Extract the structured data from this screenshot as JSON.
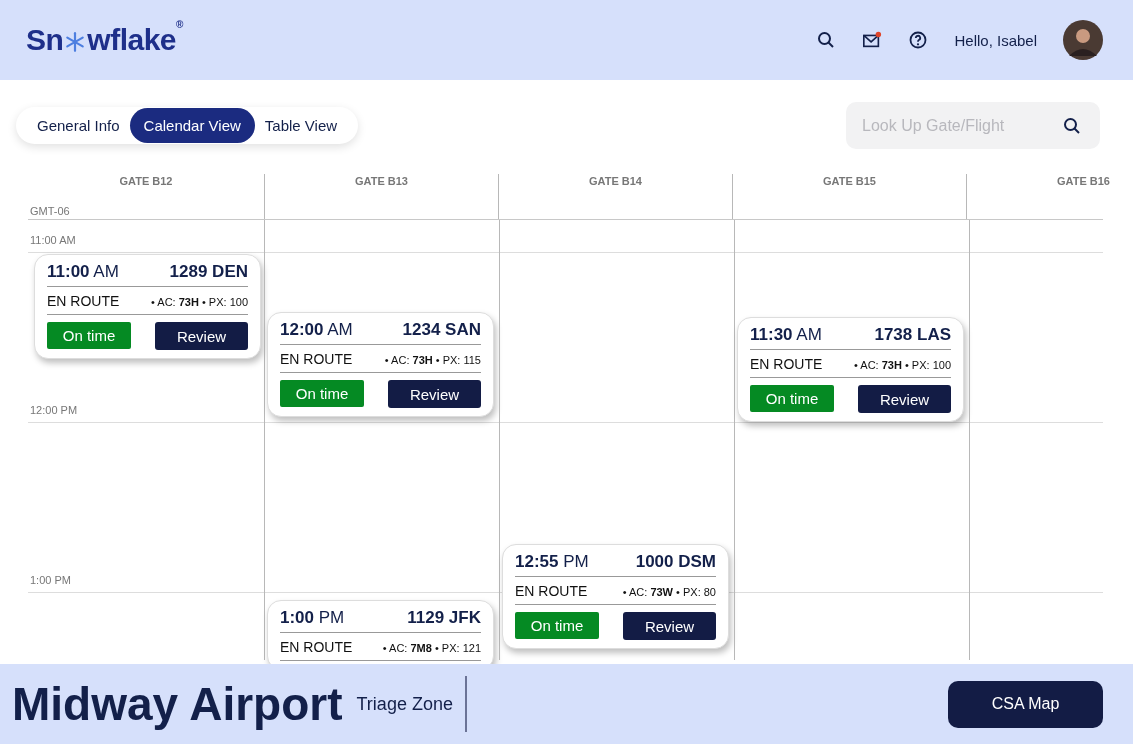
{
  "header": {
    "logo": {
      "before": "Sn",
      "after": "wflake",
      "mark": "®"
    },
    "mail_unread": true,
    "greeting": "Hello, Isabel"
  },
  "tabs": [
    {
      "label": "General Info",
      "selected": false
    },
    {
      "label": "Calendar View",
      "selected": true
    },
    {
      "label": "Table View",
      "selected": false
    }
  ],
  "search": {
    "placeholder": "Look Up Gate/Flight"
  },
  "calendar": {
    "timezone": "GMT-06",
    "time_labels": [
      "11:00 AM",
      "12:00 PM",
      "1:00 PM"
    ],
    "gates": [
      {
        "label": "GATE B12",
        "flights": [
          {
            "time": "**11:00** AM",
            "flight": "1289 DEN",
            "status": "EN ROUTE",
            "meta": "• AC: **73H** • PX: 100",
            "badge": "On time",
            "action": "Review"
          }
        ]
      },
      {
        "label": "GATE B13",
        "flights": [
          {
            "time": "**12:00** AM",
            "flight": "1234 SAN",
            "status": "EN ROUTE",
            "meta": "• AC: **73H** • PX: 115",
            "badge": "On time",
            "action": "Review"
          },
          {
            "time": "**1:00** PM",
            "flight": "1129 JFK",
            "status": "EN ROUTE",
            "meta": "• AC: **7M8** • PX: 121"
          }
        ]
      },
      {
        "label": "GATE B14",
        "flights": [
          {
            "time": "**12:55** PM",
            "flight": "1000 DSM",
            "status": "EN ROUTE",
            "meta": "• AC: **73W** • PX: 80",
            "badge": "On time",
            "action": "Review"
          }
        ]
      },
      {
        "label": "GATE B15",
        "flights": [
          {
            "time": "**11:30** AM",
            "flight": "1738 LAS",
            "status": "EN ROUTE",
            "meta": "• AC: **73H** • PX: 100",
            "badge": "On time",
            "action": "Review"
          }
        ]
      },
      {
        "label": "GATE B16"
      }
    ]
  },
  "footer": {
    "title": "Midway Airport",
    "subtitle": "Triage Zone",
    "button": "CSA Map"
  }
}
